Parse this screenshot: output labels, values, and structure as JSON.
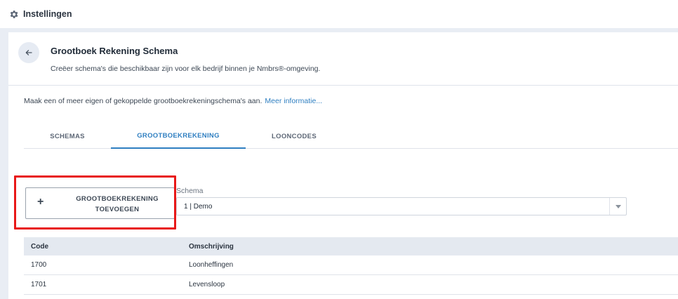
{
  "topbar": {
    "title": "Instellingen",
    "icon": "gear-icon"
  },
  "header": {
    "title": "Grootboek Rekening Schema",
    "subtitle": "Creëer schema's die beschikbaar zijn voor elk bedrijf binnen je Nmbrs®-omgeving."
  },
  "intro": {
    "text": "Maak een of meer eigen of gekoppelde grootboekrekeningschema's aan.",
    "link": "Meer informatie..."
  },
  "tabs": [
    {
      "label": "SCHEMAS",
      "active": false
    },
    {
      "label": "GROOTBOEKREKENING",
      "active": true
    },
    {
      "label": "LOONCODES",
      "active": false
    }
  ],
  "add_button": {
    "line1": "GROOTBOEKREKENING",
    "line2": "TOEVOEGEN"
  },
  "schema": {
    "label": "Schema",
    "value": "1 | Demo"
  },
  "table": {
    "columns": [
      "Code",
      "Omschrijving"
    ],
    "rows": [
      {
        "code": "1700",
        "description": "Loonheffingen"
      },
      {
        "code": "1701",
        "description": "Levensloop"
      }
    ]
  },
  "colors": {
    "accent": "#2f7fc1",
    "highlight": "#e81818",
    "header_bg": "#e4e9f0"
  }
}
